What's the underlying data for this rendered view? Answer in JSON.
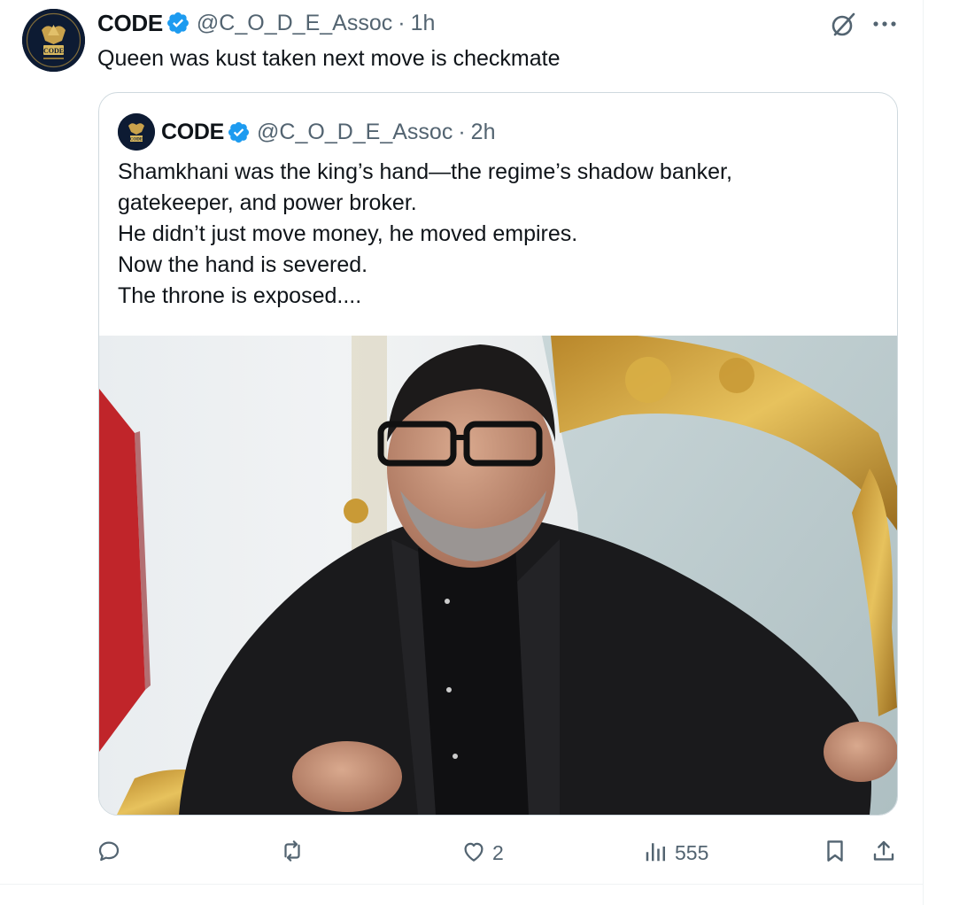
{
  "post": {
    "author_name": "CODE",
    "handle": "@C_O_D_E_Assoc",
    "separator": "·",
    "time": "1h",
    "text": "Queen was kust taken next move is checkmate",
    "avatar_label": "CODE"
  },
  "quoted_post": {
    "author_name": "CODE",
    "handle": "@C_O_D_E_Assoc",
    "separator": "·",
    "time": "2h",
    "lines": [
      "Shamkhani was the king’s hand—the regime’s shadow banker,",
      "gatekeeper, and power broker.",
      "He didn’t just move money, he moved empires.",
      "Now the hand is severed.",
      "The throne is exposed...."
    ],
    "avatar_label": "CODE"
  },
  "actions": {
    "reply_count": "",
    "repost_count": "",
    "like_count": "2",
    "views_count": "555"
  },
  "icons": {
    "verified": "verified-badge-icon",
    "grok": "grok-icon",
    "more": "more-options-icon",
    "reply": "reply-icon",
    "repost": "repost-icon",
    "like": "like-icon",
    "views": "views-icon",
    "bookmark": "bookmark-icon",
    "share": "share-icon"
  },
  "colors": {
    "text": "#0f1419",
    "secondary": "#536471",
    "verified_blue": "#1d9bf0",
    "border": "#cfd9de"
  }
}
